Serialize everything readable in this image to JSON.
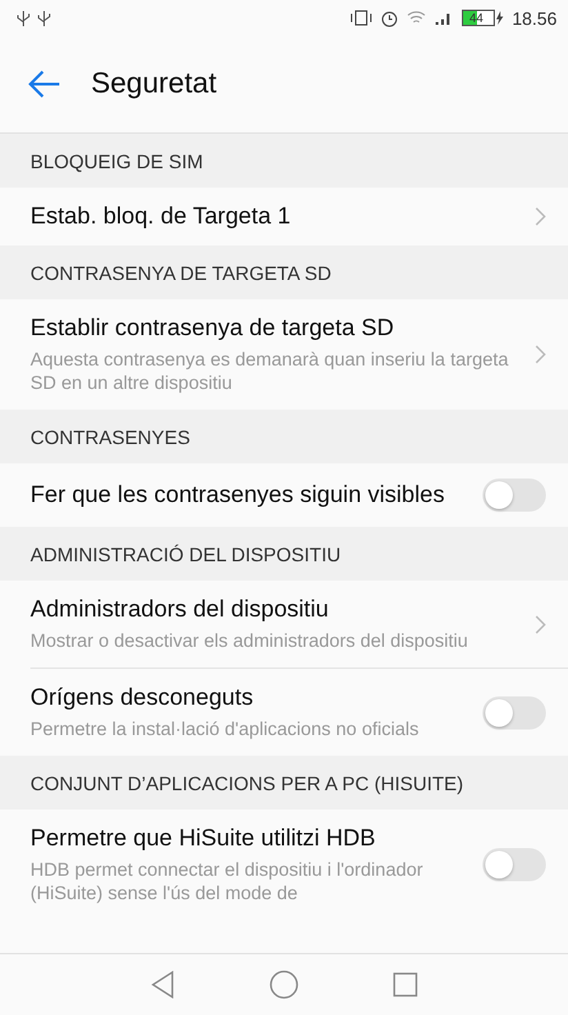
{
  "status_bar": {
    "time": "18.56",
    "battery": "44"
  },
  "header": {
    "title": "Seguretat"
  },
  "sections": [
    {
      "title": "BLOQUEIG DE SIM",
      "items": [
        {
          "kind": "link",
          "title": "Estab. bloq. de Targeta 1"
        }
      ]
    },
    {
      "title": "CONTRASENYA DE TARGETA SD",
      "items": [
        {
          "kind": "link",
          "title": "Establir contrasenya de targeta SD",
          "subtitle": "Aquesta contrasenya es demanarà quan inseriu la targeta SD en un altre dispositiu"
        }
      ]
    },
    {
      "title": "CONTRASENYES",
      "items": [
        {
          "kind": "switch",
          "title": "Fer que les contrasenyes siguin visibles",
          "on": false
        }
      ]
    },
    {
      "title": "ADMINISTRACIÓ DEL DISPOSITIU",
      "items": [
        {
          "kind": "link",
          "title": "Administradors del dispositiu",
          "subtitle": "Mostrar o desactivar els administradors del dispositiu"
        },
        {
          "kind": "switch",
          "title": "Orígens desconeguts",
          "subtitle": "Permetre la instal·lació d'aplicacions no oficials",
          "on": false
        }
      ]
    },
    {
      "title": "CONJUNT D’APLICACIONS PER A PC (HISUITE)",
      "items": [
        {
          "kind": "switch",
          "title": "Permetre que HiSuite utilitzi HDB",
          "subtitle": "HDB permet connectar el dispositiu i l'ordinador (HiSuite) sense l'ús del mode de",
          "on": false
        }
      ]
    }
  ]
}
